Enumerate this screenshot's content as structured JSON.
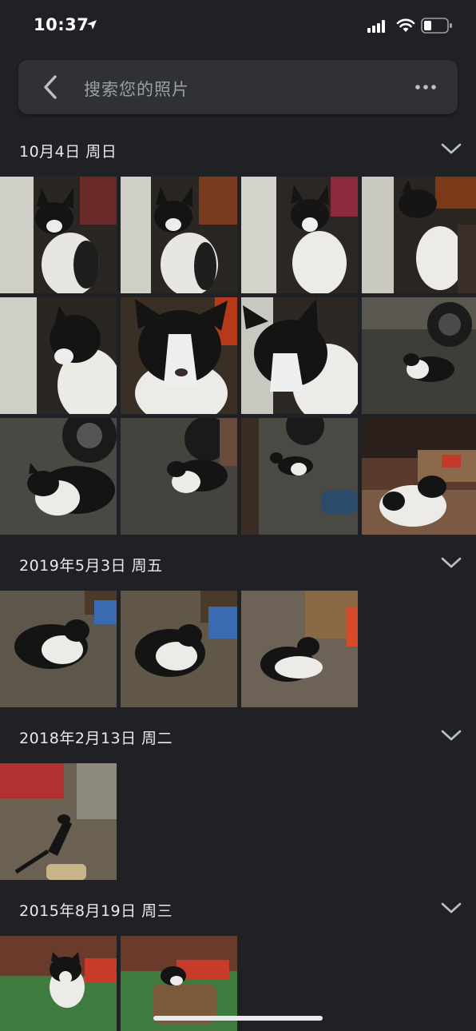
{
  "status_bar": {
    "time": "10:37"
  },
  "search": {
    "placeholder": "搜索您的照片"
  },
  "groups": [
    {
      "date": "10月4日 周日"
    },
    {
      "date": "2019年5月3日 周五"
    },
    {
      "date": "2018年2月13日 周二"
    },
    {
      "date": "2015年8月19日 周三"
    }
  ],
  "icons": {
    "location": "location-arrow-icon",
    "signal": "signal-icon",
    "wifi": "wifi-icon",
    "battery": "battery-icon",
    "back": "back-arrow-icon",
    "more": "more-horizontal-icon",
    "collapse": "chevron-down-icon"
  },
  "colors": {
    "background": "#202124",
    "search_bar": "#303134",
    "text": "#e8eaed",
    "placeholder": "#9aa0a6"
  }
}
